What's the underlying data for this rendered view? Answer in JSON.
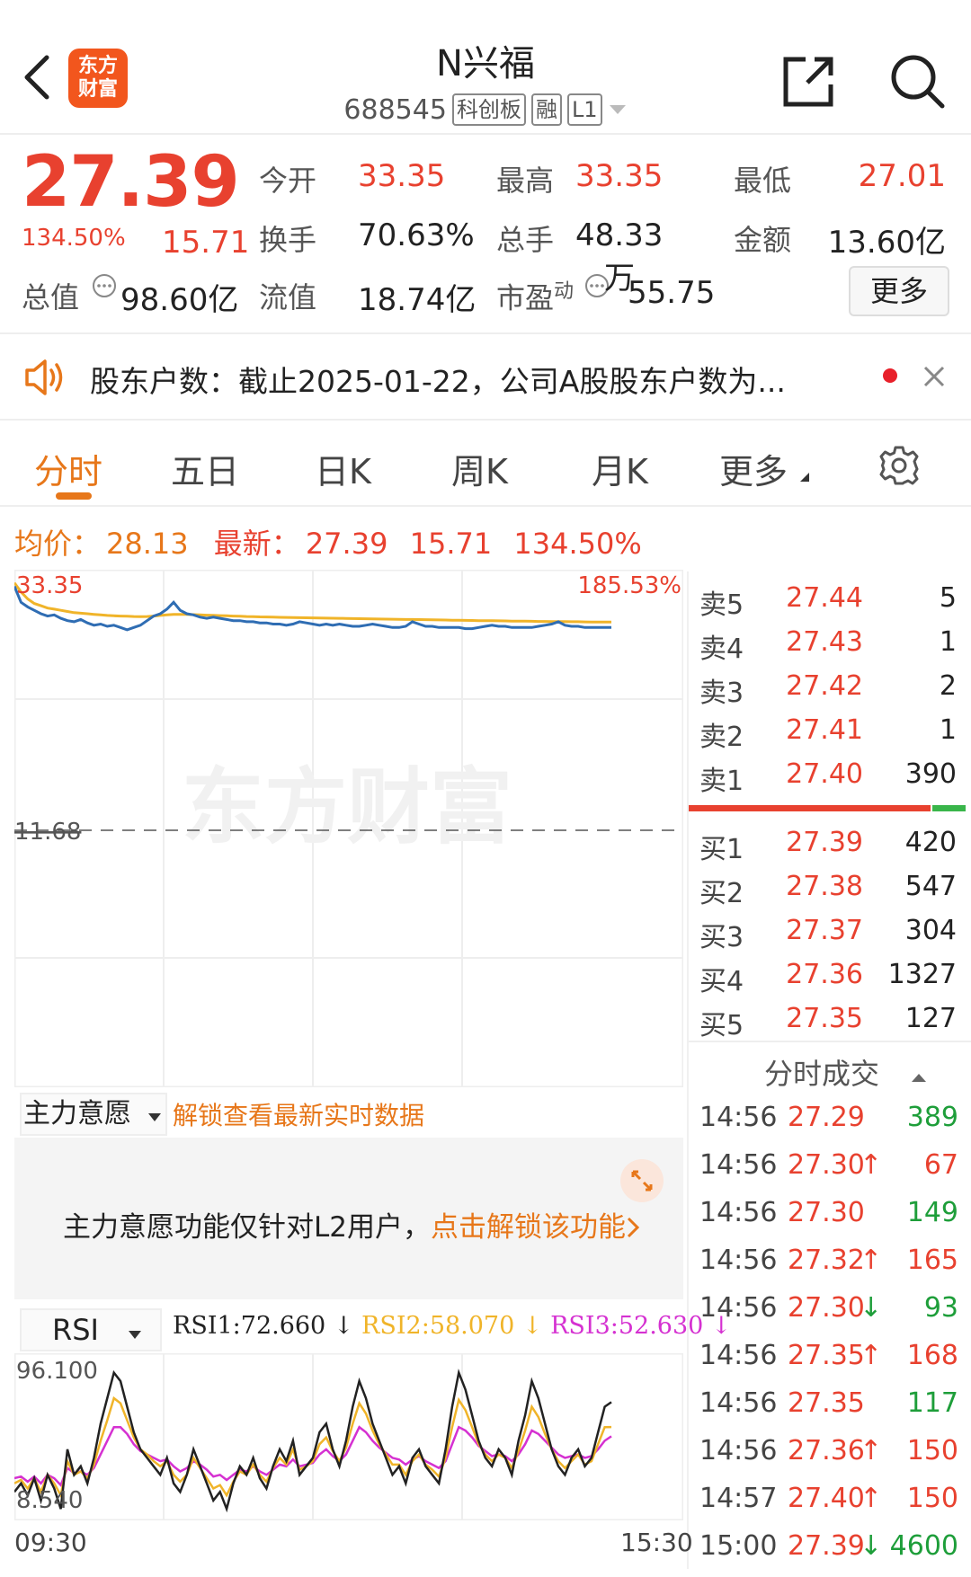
{
  "header": {
    "logo_line1": "东方",
    "logo_line2": "财富",
    "title": "N兴福",
    "code": "688545",
    "tag_board": "科创板",
    "tag_margin": "融",
    "tag_level": "L1"
  },
  "quote": {
    "price": "27.39",
    "change_pct": "134.50%",
    "change": "15.71",
    "rows": [
      [
        {
          "label": "今开",
          "value": "33.35",
          "color": "red"
        },
        {
          "label": "最高",
          "value": "33.35",
          "color": "red"
        },
        {
          "label": "最低",
          "value": "27.01",
          "color": "red"
        }
      ],
      [
        {
          "label": "换手",
          "value": "70.63%",
          "color": "dark"
        },
        {
          "label": "总手",
          "value": "48.33万",
          "color": "dark"
        },
        {
          "label": "金额",
          "value": "13.60亿",
          "color": "dark"
        }
      ]
    ],
    "total_cap_label": "总值",
    "total_cap": "98.60亿",
    "float_cap_label": "流值",
    "float_cap": "18.74亿",
    "pe_label": "市盈",
    "pe_sup": "动",
    "pe": "55.75",
    "more_label": "更多"
  },
  "notice": {
    "text": "股东户数：截止2025-01-22，公司A股股东户数为..."
  },
  "tabs": [
    "分时",
    "五日",
    "日K",
    "周K",
    "月K",
    "更多"
  ],
  "summary": {
    "avg_label": "均价：",
    "avg": "28.13",
    "latest_label": "最新：",
    "latest": "27.39",
    "change": "15.71",
    "change_pct": "134.50%"
  },
  "chart_data": [
    {
      "type": "line",
      "title": "",
      "x_start": "09:30",
      "x_end": "15:30",
      "y_max_label": "33.35",
      "y_max_pct_label": "185.53%",
      "prev_close_label": "11.68",
      "ylim": [
        11.68,
        33.35
      ],
      "series": [
        {
          "values": [
            33.0,
            31.6,
            31.2,
            30.9,
            30.6,
            30.4,
            30.5,
            30.2,
            30.0,
            29.9,
            30.1,
            29.8,
            29.6,
            29.7,
            29.5,
            29.6,
            29.4,
            29.2,
            29.4,
            29.6,
            30.0,
            30.4,
            30.6,
            31.0,
            31.6,
            30.9,
            30.6,
            30.5,
            30.3,
            30.2,
            30.3,
            30.2,
            30.1,
            30.0,
            30.0,
            29.9,
            29.9,
            29.8,
            29.8,
            29.7,
            29.7,
            29.6,
            29.7,
            29.9,
            29.8,
            29.7,
            29.6,
            29.7,
            29.6,
            29.7,
            29.6,
            29.5,
            29.5,
            29.6,
            29.7,
            29.6,
            29.5,
            29.4,
            29.4,
            29.5,
            29.9,
            29.7,
            29.5,
            29.5,
            29.4,
            29.4,
            29.4,
            29.4,
            29.3,
            29.3,
            29.4,
            29.5,
            29.6,
            29.5,
            29.5,
            29.4,
            29.4,
            29.4,
            29.4,
            29.5,
            29.6,
            29.7,
            29.9,
            29.6,
            29.5,
            29.5,
            29.4,
            29.4,
            29.4,
            29.4,
            29.4
          ]
        },
        {
          "values": [
            33.3,
            32.5,
            31.9,
            31.5,
            31.3,
            31.1,
            31.0,
            30.9,
            30.8,
            30.7,
            30.65,
            30.6,
            30.55,
            30.5,
            30.45,
            30.42,
            30.4,
            30.38,
            30.36,
            30.35,
            30.36,
            30.4,
            30.45,
            30.5,
            30.55,
            30.55,
            30.54,
            30.52,
            30.5,
            30.48,
            30.46,
            30.44,
            30.42,
            30.4,
            30.38,
            30.36,
            30.35,
            30.33,
            30.32,
            30.3,
            30.29,
            30.28,
            30.27,
            30.26,
            30.25,
            30.24,
            30.23,
            30.22,
            30.21,
            30.2,
            30.19,
            30.18,
            30.17,
            30.16,
            30.15,
            30.14,
            30.13,
            30.12,
            30.11,
            30.1,
            30.1,
            30.09,
            30.08,
            30.07,
            30.06,
            30.05,
            30.04,
            30.03,
            30.02,
            30.01,
            30.0,
            30.0,
            29.99,
            29.98,
            29.97,
            29.96,
            29.95,
            29.95,
            29.94,
            29.93,
            29.93,
            29.92,
            29.92,
            29.91,
            29.9,
            29.9,
            29.89,
            29.88,
            29.88,
            29.87,
            29.87
          ]
        }
      ]
    },
    {
      "type": "line",
      "title": "RSI",
      "y_max_label": "96.100",
      "y_min_label": "8.540",
      "ylim": [
        8.54,
        96.1
      ],
      "rsi1_label": "RSI1:72.660",
      "rsi2_label": "RSI2:58.070",
      "rsi3_label": "RSI3:52.630",
      "series": [
        {
          "values": [
            20,
            25,
            18,
            28,
            15,
            30,
            22,
            10,
            45,
            30,
            35,
            25,
            40,
            60,
            75,
            90,
            85,
            70,
            55,
            45,
            40,
            35,
            30,
            40,
            25,
            20,
            30,
            45,
            35,
            25,
            15,
            20,
            10,
            25,
            35,
            30,
            40,
            28,
            22,
            35,
            45,
            38,
            50,
            30,
            35,
            40,
            55,
            60,
            45,
            35,
            50,
            70,
            85,
            75,
            60,
            50,
            40,
            30,
            35,
            25,
            40,
            45,
            35,
            30,
            25,
            45,
            70,
            90,
            80,
            65,
            50,
            40,
            35,
            45,
            40,
            30,
            50,
            65,
            85,
            75,
            60,
            45,
            35,
            30,
            40,
            45,
            35,
            40,
            55,
            70,
            72.66
          ]
        },
        {
          "values": [
            25,
            27,
            22,
            28,
            20,
            30,
            25,
            18,
            38,
            30,
            32,
            28,
            36,
            50,
            62,
            75,
            72,
            62,
            52,
            45,
            42,
            38,
            35,
            38,
            30,
            26,
            30,
            40,
            34,
            28,
            22,
            24,
            18,
            26,
            32,
            30,
            36,
            30,
            26,
            34,
            40,
            36,
            45,
            33,
            35,
            38,
            48,
            52,
            44,
            38,
            46,
            60,
            72,
            66,
            56,
            48,
            42,
            36,
            36,
            30,
            38,
            42,
            36,
            33,
            29,
            40,
            58,
            74,
            68,
            58,
            48,
            42,
            38,
            42,
            40,
            34,
            44,
            56,
            70,
            64,
            54,
            45,
            38,
            34,
            38,
            42,
            36,
            38,
            48,
            58,
            58.07
          ]
        },
        {
          "values": [
            28,
            29,
            26,
            29,
            25,
            30,
            28,
            24,
            34,
            31,
            32,
            30,
            34,
            42,
            50,
            58,
            58,
            54,
            48,
            44,
            42,
            40,
            38,
            39,
            35,
            32,
            34,
            38,
            36,
            33,
            29,
            30,
            27,
            30,
            33,
            32,
            35,
            32,
            30,
            33,
            36,
            35,
            39,
            35,
            36,
            37,
            42,
            45,
            41,
            38,
            42,
            50,
            58,
            55,
            50,
            46,
            43,
            40,
            39,
            36,
            39,
            41,
            38,
            36,
            34,
            38,
            48,
            58,
            56,
            52,
            47,
            44,
            41,
            42,
            41,
            38,
            42,
            48,
            56,
            54,
            50,
            46,
            42,
            40,
            41,
            42,
            40,
            41,
            45,
            50,
            52.63
          ]
        }
      ]
    }
  ],
  "order_book": {
    "asks": [
      {
        "label": "卖5",
        "price": "27.44",
        "vol": "5"
      },
      {
        "label": "卖4",
        "price": "27.43",
        "vol": "1"
      },
      {
        "label": "卖3",
        "price": "27.42",
        "vol": "2"
      },
      {
        "label": "卖2",
        "price": "27.41",
        "vol": "1"
      },
      {
        "label": "卖1",
        "price": "27.40",
        "vol": "390"
      }
    ],
    "bids": [
      {
        "label": "买1",
        "price": "27.39",
        "vol": "420"
      },
      {
        "label": "买2",
        "price": "27.38",
        "vol": "547"
      },
      {
        "label": "买3",
        "price": "27.37",
        "vol": "304"
      },
      {
        "label": "买4",
        "price": "27.36",
        "vol": "1327"
      },
      {
        "label": "买5",
        "price": "27.35",
        "vol": "127"
      }
    ],
    "bid_ratio": 0.88
  },
  "ticks": {
    "header": "分时成交",
    "rows": [
      {
        "time": "14:56",
        "price": "27.29",
        "arrow": "",
        "vol": "389",
        "vcolor": "green"
      },
      {
        "time": "14:56",
        "price": "27.30",
        "arrow": "↑",
        "vol": "67",
        "vcolor": "red"
      },
      {
        "time": "14:56",
        "price": "27.30",
        "arrow": "",
        "vol": "149",
        "vcolor": "green"
      },
      {
        "time": "14:56",
        "price": "27.32",
        "arrow": "↑",
        "vol": "165",
        "vcolor": "red"
      },
      {
        "time": "14:56",
        "price": "27.30",
        "arrow": "↓",
        "vol": "93",
        "vcolor": "green"
      },
      {
        "time": "14:56",
        "price": "27.35",
        "arrow": "↑",
        "vol": "168",
        "vcolor": "red"
      },
      {
        "time": "14:56",
        "price": "27.35",
        "arrow": "",
        "vol": "117",
        "vcolor": "green"
      },
      {
        "time": "14:56",
        "price": "27.36",
        "arrow": "↑",
        "vol": "150",
        "vcolor": "red"
      },
      {
        "time": "14:57",
        "price": "27.40",
        "arrow": "↑",
        "vol": "150",
        "vcolor": "red"
      },
      {
        "time": "15:00",
        "price": "27.39",
        "arrow": "↓",
        "vol": "4600",
        "vcolor": "green"
      }
    ]
  },
  "zhuli": {
    "select_label": "主力意愿",
    "unlock_link": "解锁查看最新实时数据",
    "panel_text": "主力意愿功能仅针对L2用户，",
    "panel_link": "点击解锁该功能",
    "watermark": "东方财富"
  },
  "rsi": {
    "select_label": "RSI"
  },
  "colors": {
    "up": "#e8412f",
    "down": "#1e9e3a",
    "accent": "#e7771a",
    "price_line": "#2f6db3",
    "avg_line": "#f0b429",
    "rsi1": "#222222",
    "rsi2": "#f0b429",
    "rsi3": "#d531d1"
  }
}
